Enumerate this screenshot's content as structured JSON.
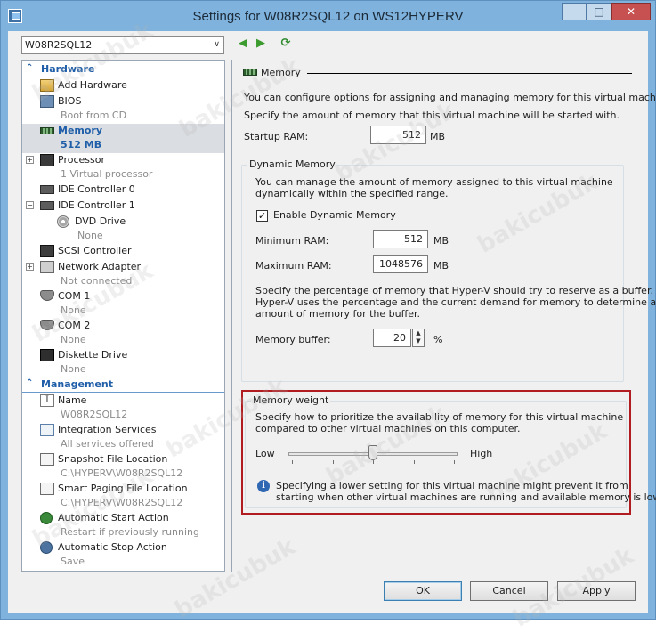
{
  "window": {
    "title": "Settings for W08R2SQL12 on WS12HYPERV",
    "minimize_glyph": "—",
    "maximize_glyph": "□",
    "close_glyph": "✕"
  },
  "vm_selector": {
    "value": "W08R2SQL12",
    "arrow": "∨"
  },
  "nav": {
    "back_glyph": "◀",
    "forward_glyph": "▶",
    "refresh_glyph": "⟳"
  },
  "tree": {
    "hardware_label": "Hardware",
    "management_label": "Management",
    "chevron": "⌃",
    "hardware": [
      {
        "label": "Add Hardware",
        "sub": "",
        "icon": "add-hardware-icon"
      },
      {
        "label": "BIOS",
        "sub": "Boot from CD",
        "icon": "bios-icon"
      },
      {
        "label": "Memory",
        "sub": "512 MB",
        "icon": "memory-icon"
      },
      {
        "label": "Processor",
        "sub": "1 Virtual processor",
        "icon": "processor-icon"
      },
      {
        "label": "IDE Controller 0",
        "sub": "",
        "icon": "ide-controller-icon"
      },
      {
        "label": "IDE Controller 1",
        "sub": "",
        "icon": "ide-controller-icon"
      },
      {
        "label": "DVD Drive",
        "sub": "None",
        "icon": "dvd-drive-icon"
      },
      {
        "label": "SCSI Controller",
        "sub": "",
        "icon": "scsi-controller-icon"
      },
      {
        "label": "Network Adapter",
        "sub": "Not connected",
        "icon": "network-adapter-icon"
      },
      {
        "label": "COM 1",
        "sub": "None",
        "icon": "com-port-icon"
      },
      {
        "label": "COM 2",
        "sub": "None",
        "icon": "com-port-icon"
      },
      {
        "label": "Diskette Drive",
        "sub": "None",
        "icon": "diskette-drive-icon"
      }
    ],
    "management": [
      {
        "label": "Name",
        "sub": "W08R2SQL12",
        "icon": "name-icon"
      },
      {
        "label": "Integration Services",
        "sub": "All services offered",
        "icon": "integration-services-icon"
      },
      {
        "label": "Snapshot File Location",
        "sub": "C:\\HYPERV\\W08R2SQL12",
        "icon": "snapshot-folder-icon"
      },
      {
        "label": "Smart Paging File Location",
        "sub": "C:\\HYPERV\\W08R2SQL12",
        "icon": "smart-paging-folder-icon"
      },
      {
        "label": "Automatic Start Action",
        "sub": "Restart if previously running",
        "icon": "automatic-start-icon"
      },
      {
        "label": "Automatic Stop Action",
        "sub": "Save",
        "icon": "automatic-stop-icon"
      }
    ],
    "expand_plus": "+",
    "expand_minus": "−"
  },
  "memory": {
    "heading": "Memory",
    "intro": "You can configure options for assigning and managing memory for this virtual machine.",
    "startup_help": "Specify the amount of memory that this virtual machine will be started with.",
    "startup_label": "Startup RAM:",
    "startup_value": "512",
    "unit_mb": "MB",
    "dynamic": {
      "title": "Dynamic Memory",
      "desc_line1": "You can manage the amount of memory assigned to this virtual machine",
      "desc_line2": "dynamically within the specified range.",
      "enable_label": "Enable Dynamic Memory",
      "enable_checked": true,
      "check_glyph": "✓",
      "min_label": "Minimum RAM:",
      "min_value": "512",
      "max_label": "Maximum RAM:",
      "max_value": "1048576",
      "buffer_desc_line1": "Specify the percentage of memory that Hyper-V should try to reserve as a buffer.",
      "buffer_desc_line2": "Hyper-V uses the percentage and the current demand for memory to determine an",
      "buffer_desc_line3": "amount of memory for the buffer.",
      "buffer_label": "Memory buffer:",
      "buffer_value": "20",
      "buffer_unit": "%",
      "spin_up": "▲",
      "spin_down": "▼"
    },
    "weight": {
      "title": "Memory weight",
      "desc_line1": "Specify how to prioritize the availability of memory for this virtual machine",
      "desc_line2": "compared to other virtual machines on this computer.",
      "low_label": "Low",
      "high_label": "High",
      "slider_value": 0.5,
      "info_glyph": "i",
      "info_line1": "Specifying a lower setting for this virtual machine might prevent it from",
      "info_line2": "starting when other virtual machines are running and available memory is low.",
      "highlight_color": "#b01c20"
    }
  },
  "buttons": {
    "ok": "OK",
    "cancel": "Cancel",
    "apply": "Apply"
  },
  "watermark": "bakicubuk",
  "colors": {
    "accent": "#1f5ea8",
    "titlebar": "#7fb2dc",
    "close": "#c75050"
  }
}
